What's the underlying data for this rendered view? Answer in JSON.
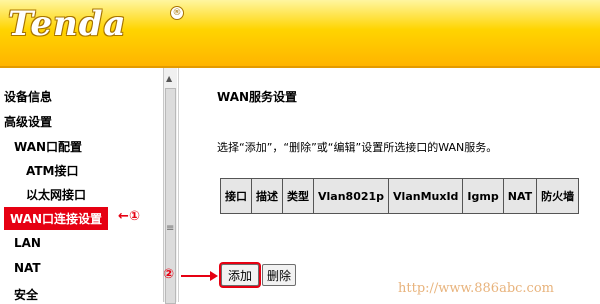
{
  "header": {
    "logo_text": "Tenda",
    "registered_mark": "®"
  },
  "sidebar": {
    "items": [
      {
        "label": "设备信息"
      },
      {
        "label": "高级设置"
      },
      {
        "label": "WAN口配置"
      },
      {
        "label": "ATM接口"
      },
      {
        "label": "以太网接口"
      },
      {
        "label": "WAN口连接设置"
      },
      {
        "label": "LAN"
      },
      {
        "label": "NAT"
      },
      {
        "label": "安全"
      }
    ],
    "scroll_grip": "≡"
  },
  "annotations": {
    "marker1": "←①",
    "marker2": "②"
  },
  "main": {
    "title": "WAN服务设置",
    "description": "选择“添加”，“删除”或“编辑”设置所选接口的WAN服务。",
    "table_headers": [
      "接口",
      "描述",
      "类型",
      "Vlan8021p",
      "VlanMuxId",
      "Igmp",
      "NAT",
      "防火墙"
    ],
    "buttons": {
      "add": "添加",
      "delete": "删除"
    }
  },
  "watermark": "http://www.886abc.com",
  "colors": {
    "header_yellow": "#ffd400",
    "highlight_red": "#e60012"
  }
}
